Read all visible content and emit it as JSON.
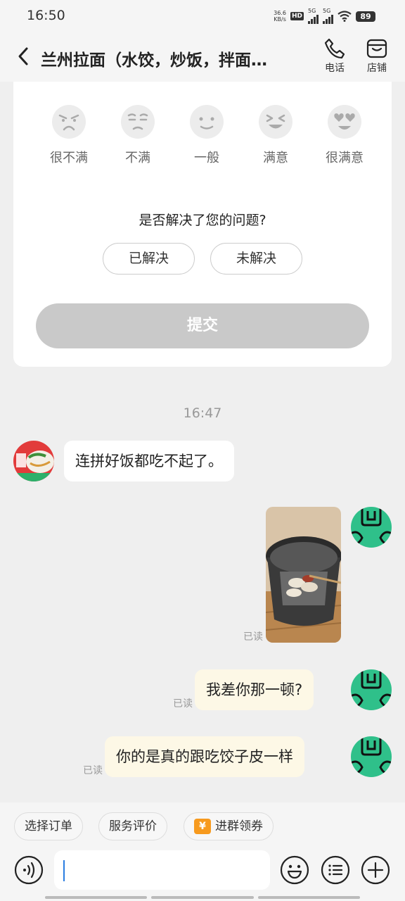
{
  "status": {
    "time": "16:50",
    "speed_value": "36.6",
    "speed_unit": "KB/s",
    "hd_label": "HD",
    "network_a": "5G",
    "network_b": "5G",
    "battery": "89"
  },
  "header": {
    "title": "兰州拉面（水饺，炒饭，拌面…",
    "phone_label": "电话",
    "store_label": "店铺"
  },
  "rating": {
    "options": [
      {
        "label": "很不满",
        "icon": "very-unsatisfied-face-icon"
      },
      {
        "label": "不满",
        "icon": "unsatisfied-face-icon"
      },
      {
        "label": "一般",
        "icon": "neutral-face-icon"
      },
      {
        "label": "满意",
        "icon": "satisfied-face-icon"
      },
      {
        "label": "很满意",
        "icon": "very-satisfied-face-icon"
      }
    ],
    "question": "是否解决了您的问题?",
    "resolved_label": "已解决",
    "unresolved_label": "未解决",
    "submit_label": "提交"
  },
  "chat": {
    "timestamp": "16:47",
    "messages": [
      {
        "side": "left",
        "type": "text",
        "text": "连拼好饭都吃不起了。"
      },
      {
        "side": "right",
        "type": "image",
        "read": "已读"
      },
      {
        "side": "right",
        "type": "text",
        "text": "我差你那一顿?",
        "read": "已读"
      },
      {
        "side": "right",
        "type": "text",
        "text": "你的是真的跟吃饺子皮一样",
        "read": "已读"
      }
    ]
  },
  "bottom": {
    "chips": [
      "选择订单",
      "服务评价",
      "进群领券"
    ],
    "coupon_icon_text": "¥",
    "input_value": ""
  },
  "colors": {
    "accent": "#2a7de1",
    "user_bubble": "#fdf8e6",
    "submit_disabled": "#c9c9c9",
    "coupon": "#f79a1e",
    "avatar_green": "#2fc08a"
  }
}
